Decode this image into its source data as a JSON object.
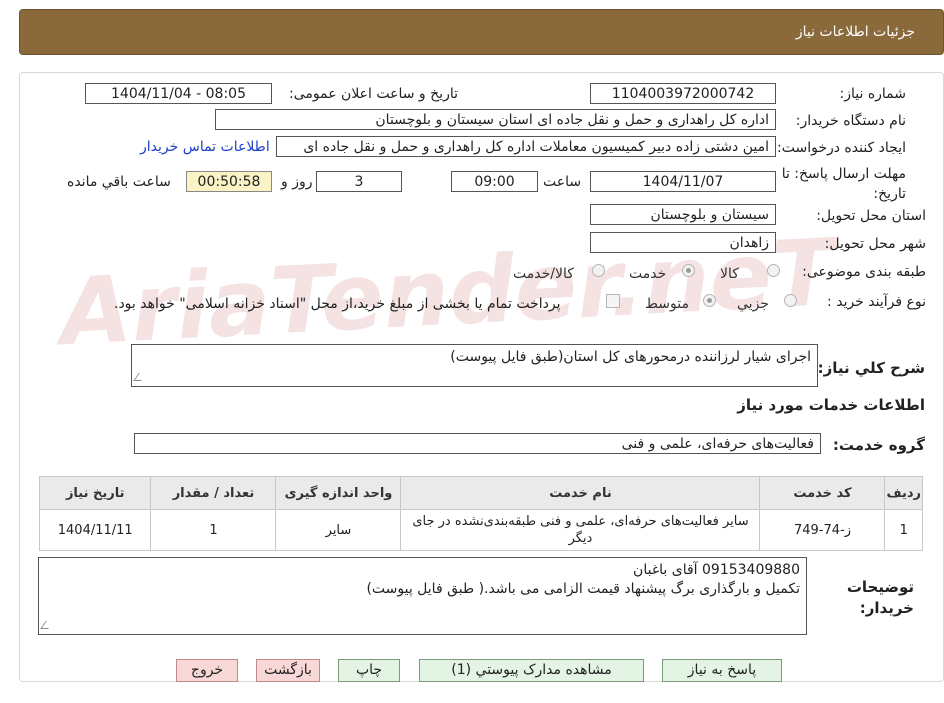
{
  "page_header": "جزئیات اطلاعات نیاز",
  "watermark": "AriaTender.neT",
  "fields": {
    "need_number_label": "شماره نیاز:",
    "need_number": "1104003972000742",
    "announce_label": "تاریخ و ساعت اعلان عمومی:",
    "announce_value": "1404/11/04 - 08:05",
    "buyer_org_label": "نام دستگاه خریدار:",
    "buyer_org": "اداره کل راهداری و حمل و نقل جاده ای استان سیستان و بلوچستان",
    "requester_label": "ایجاد کننده درخواست:",
    "requester": "امین دشتی زاده دبیر کمیسیون معاملات اداره کل راهداری و حمل و نقل جاده ای",
    "contact_link": "اطلاعات تماس خریدار",
    "deadline_label": "مهلت ارسال پاسخ: تا تاریخ:",
    "deadline_date": "1404/11/07",
    "time_word": "ساعت",
    "deadline_time": "09:00",
    "days": "3",
    "days_word": "روز و",
    "remaining": "00:50:58",
    "remaining_word": "ساعت باقي مانده",
    "province_label": "استان محل تحویل:",
    "province": "سیستان و بلوچستان",
    "city_label": "شهر محل تحویل:",
    "city": "زاهدان",
    "category_label": "طبقه بندی موضوعی:",
    "category_options": [
      "کالا",
      "خدمت",
      "کالا/خدمت"
    ],
    "category_selected": "خدمت",
    "process_label": "نوع فرآیند خرید :",
    "process_options": [
      "جزيي",
      "متوسط"
    ],
    "process_selected": "متوسط",
    "payment_note": "پرداخت تمام یا بخشی از مبلغ خرید،از محل \"اسناد خزانه اسلامی\" خواهد بود.",
    "summary_label": "شرح کلي نياز:",
    "summary": "اجرای شیار لرزاننده درمحورهای کل استان(طبق فایل پیوست)",
    "services_heading": "اطلاعات خدمات مورد نیاز",
    "service_group_label": "گروه خدمت:",
    "service_group": "فعالیت‌های حرفه‌ای، علمی و فنی"
  },
  "table": {
    "headers": [
      "ردیف",
      "کد خدمت",
      "نام خدمت",
      "واحد اندازه گیری",
      "تعداد / مقدار",
      "تاریخ نیاز"
    ],
    "rows": [
      [
        "1",
        "ز-74-749",
        "سایر فعالیت‌های حرفه‌ای، علمی و فنی طبقه‌بندی‌نشده در جای دیگر",
        "سایر",
        "1",
        "1404/11/11"
      ]
    ]
  },
  "buyer_notes": {
    "label": "توضیحات خریدار:",
    "line1": "09153409880 آقای باغبان",
    "line2": "تکمیل و بارگذاری برگ پیشنهاد قیمت الزامی می باشد.( طبق فایل پیوست)"
  },
  "buttons": {
    "respond": "پاسخ به نیاز",
    "attachments": "مشاهده مدارک پیوستي (1)",
    "print": "چاپ",
    "back": "بازگشت",
    "exit": "خروج"
  }
}
